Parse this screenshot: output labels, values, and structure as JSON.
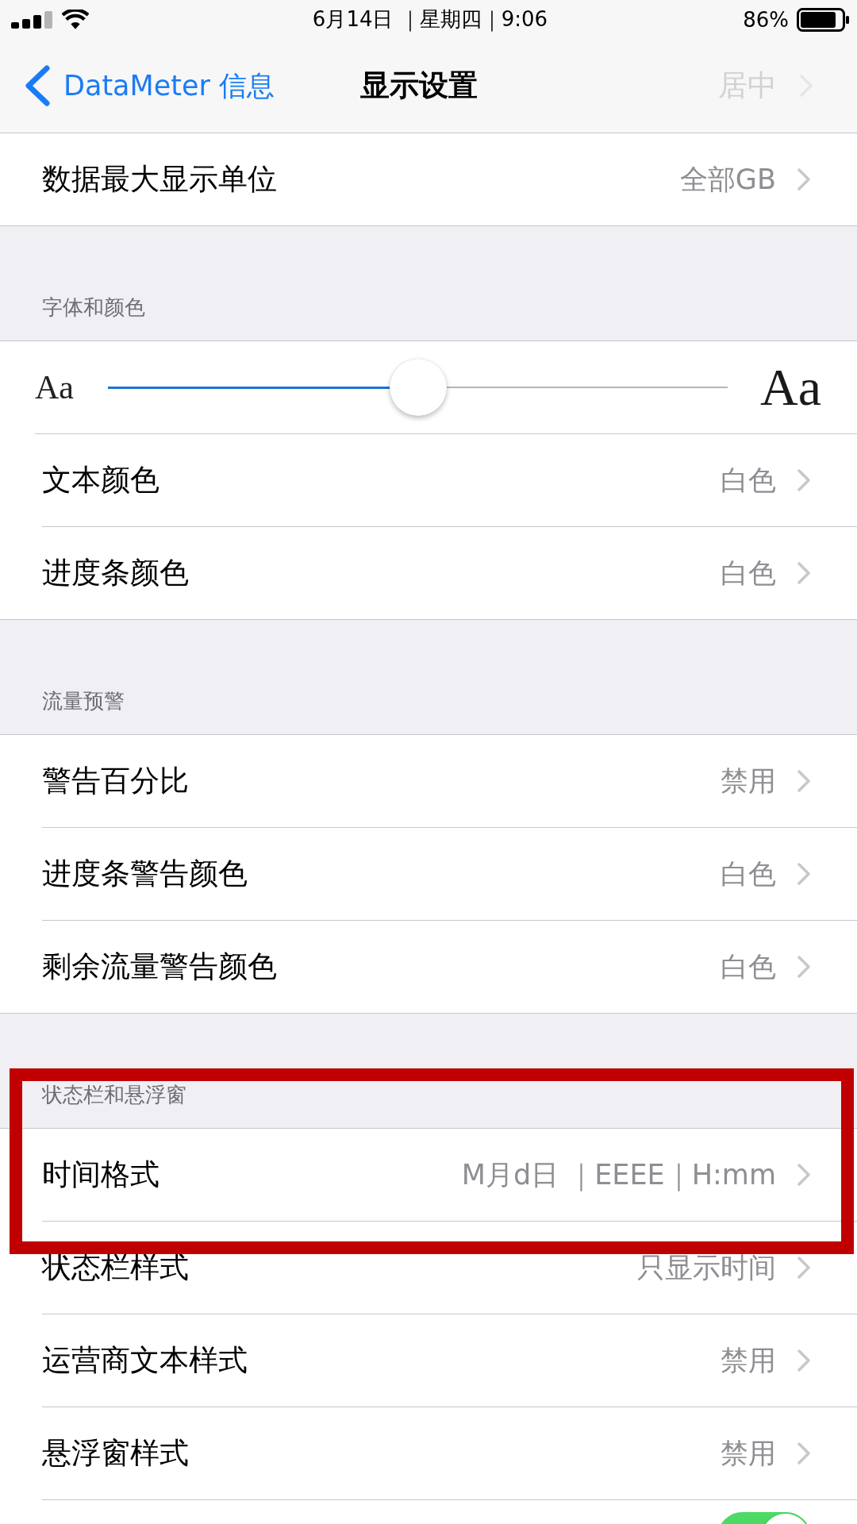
{
  "status_bar": {
    "time": "6月14日 ｜星期四｜9:06",
    "battery": "86%"
  },
  "nav": {
    "back": "DataMeter 信息",
    "title": "显示设置",
    "behind_value": "居中"
  },
  "sections": [
    {
      "highlighted": false,
      "rows": [
        {
          "kind": "value",
          "label": "数据最大显示单位",
          "value": "全部GB"
        }
      ]
    },
    {
      "header": "字体和颜色",
      "highlighted": false,
      "rows": [
        {
          "kind": "slider",
          "small_label": "Aa",
          "large_label": "Aa",
          "level": 0.5
        },
        {
          "kind": "value",
          "label": "文本颜色",
          "value": "白色"
        },
        {
          "kind": "value",
          "label": "进度条颜色",
          "value": "白色"
        }
      ]
    },
    {
      "header": "流量预警",
      "highlighted": false,
      "rows": [
        {
          "kind": "value",
          "label": "警告百分比",
          "value": "禁用"
        },
        {
          "kind": "value",
          "label": "进度条警告颜色",
          "value": "白色"
        },
        {
          "kind": "value",
          "label": "剩余流量警告颜色",
          "value": "白色"
        }
      ]
    },
    {
      "header": "状态栏和悬浮窗",
      "highlighted": true,
      "rows": [
        {
          "kind": "value",
          "label": "时间格式",
          "value": "M月d日 ｜EEEE｜H:mm"
        },
        {
          "kind": "value",
          "label": "状态栏样式",
          "value": "只显示时间"
        },
        {
          "kind": "value",
          "label": "运营商文本样式",
          "value": "禁用"
        },
        {
          "kind": "value",
          "label": "悬浮窗样式",
          "value": "禁用"
        },
        {
          "kind": "toggle",
          "on": true
        }
      ]
    }
  ]
}
